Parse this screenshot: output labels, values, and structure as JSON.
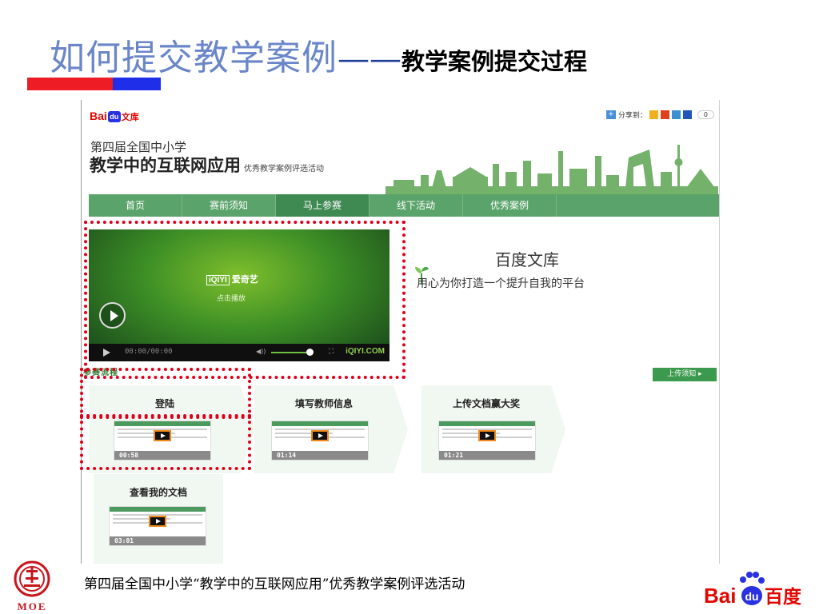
{
  "slide": {
    "title_main": "如何提交教学案例",
    "title_dash": "——",
    "title_sub": "教学案例提交过程",
    "footer": "第四届全国中小学“教学中的互联网应用”优秀教学案例评选活动",
    "moe_label": "MOE"
  },
  "site": {
    "logo_bai": "Bai",
    "logo_du": "du",
    "logo_wenku": "文库",
    "share_label": "分享到：",
    "share_count": "0",
    "event_line1": "第四届全国中小学",
    "event_line2": "教学中的互联网应用",
    "event_line2_sub": "优秀教学案例评选活动",
    "nav": [
      {
        "label": "首页"
      },
      {
        "label": "赛前须知"
      },
      {
        "label": "马上参赛"
      },
      {
        "label": "线下活动"
      },
      {
        "label": "优秀案例"
      }
    ],
    "nav_active_index": 2
  },
  "video": {
    "logo": "iQIYI",
    "logo_cn": "爱奇艺",
    "hint": "点击播放",
    "time": "00:00/00:00",
    "brand": "iQIYI.COM"
  },
  "wenku": {
    "title": "百度文库",
    "slogan": "用心为你打造一个提升自我的平台"
  },
  "flow": {
    "label": "参赛流程",
    "upload_notice": "上传须知 ▸",
    "steps": [
      {
        "title": "登陆",
        "time": "00:58"
      },
      {
        "title": "填写教师信息",
        "time": "01:14"
      },
      {
        "title": "上传文档赢大奖",
        "time": "01:21"
      },
      {
        "title": "查看我的文档",
        "time": "03:01"
      }
    ]
  },
  "colors": {
    "title_blue": "#6a86c8",
    "bar_red": "#ee1c24",
    "bar_blue": "#1f2ee8",
    "nav_green": "#5aa36a",
    "highlight_red": "#e0001a"
  },
  "corner_logo": {
    "bai": "Bai",
    "du": "du",
    "baidu": "百度"
  }
}
